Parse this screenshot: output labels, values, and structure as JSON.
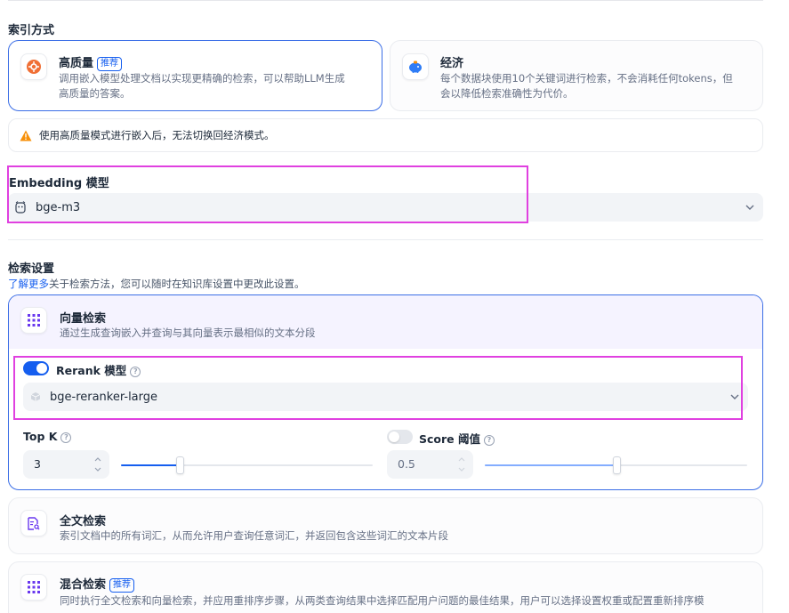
{
  "index_method": {
    "title": "索引方式",
    "high_quality": {
      "title": "高质量",
      "badge": "推荐",
      "desc_line1": "调用嵌入模型处理文档以实现更精确的检索，可以帮助LLM生成",
      "desc_line2": "高质量的答案。",
      "icon": "sparkle-icon"
    },
    "economy": {
      "title": "经济",
      "desc_line1": "每个数据块使用10个关键词进行检索，不会消耗任何tokens，但",
      "desc_line2": "会以降低检索准确性为代价。",
      "icon": "piggy-bank-icon"
    },
    "warning": "使用高质量模式进行嵌入后，无法切换回经济模式。"
  },
  "embedding": {
    "label": "Embedding 模型",
    "model": "bge-m3"
  },
  "retrieval": {
    "title": "检索设置",
    "learn_more": "了解更多",
    "subtitle": "关于检索方法，您可以随时在知识库设置中更改此设置。",
    "vector": {
      "title": "向量检索",
      "desc": "通过生成查询嵌入并查询与其向量表示最相似的文本分段"
    },
    "rerank": {
      "label": "Rerank 模型",
      "enabled": true,
      "model": "bge-reranker-large"
    },
    "top_k": {
      "label": "Top K",
      "value": "3",
      "slider_fraction": 0.1
    },
    "score": {
      "label": "Score 阈值",
      "enabled": false,
      "value": "0.5",
      "slider_fraction": 0.5
    },
    "fulltext": {
      "title": "全文检索",
      "desc": "索引文档中的所有词汇，从而允许用户查询任意词汇，并返回包含这些词汇的文本片段"
    },
    "hybrid": {
      "title": "混合检索",
      "badge": "推荐",
      "desc": "同时执行全文检索和向量检索，并应用重排序步骤，从两类查询结果中选择匹配用户问题的最佳结果，用户可以选择设置权重或配置重新排序模"
    }
  },
  "colors": {
    "accent": "#155eef",
    "highlight": "#e040e0",
    "warning": "#f79009",
    "vector_icon": "#6938ef"
  }
}
